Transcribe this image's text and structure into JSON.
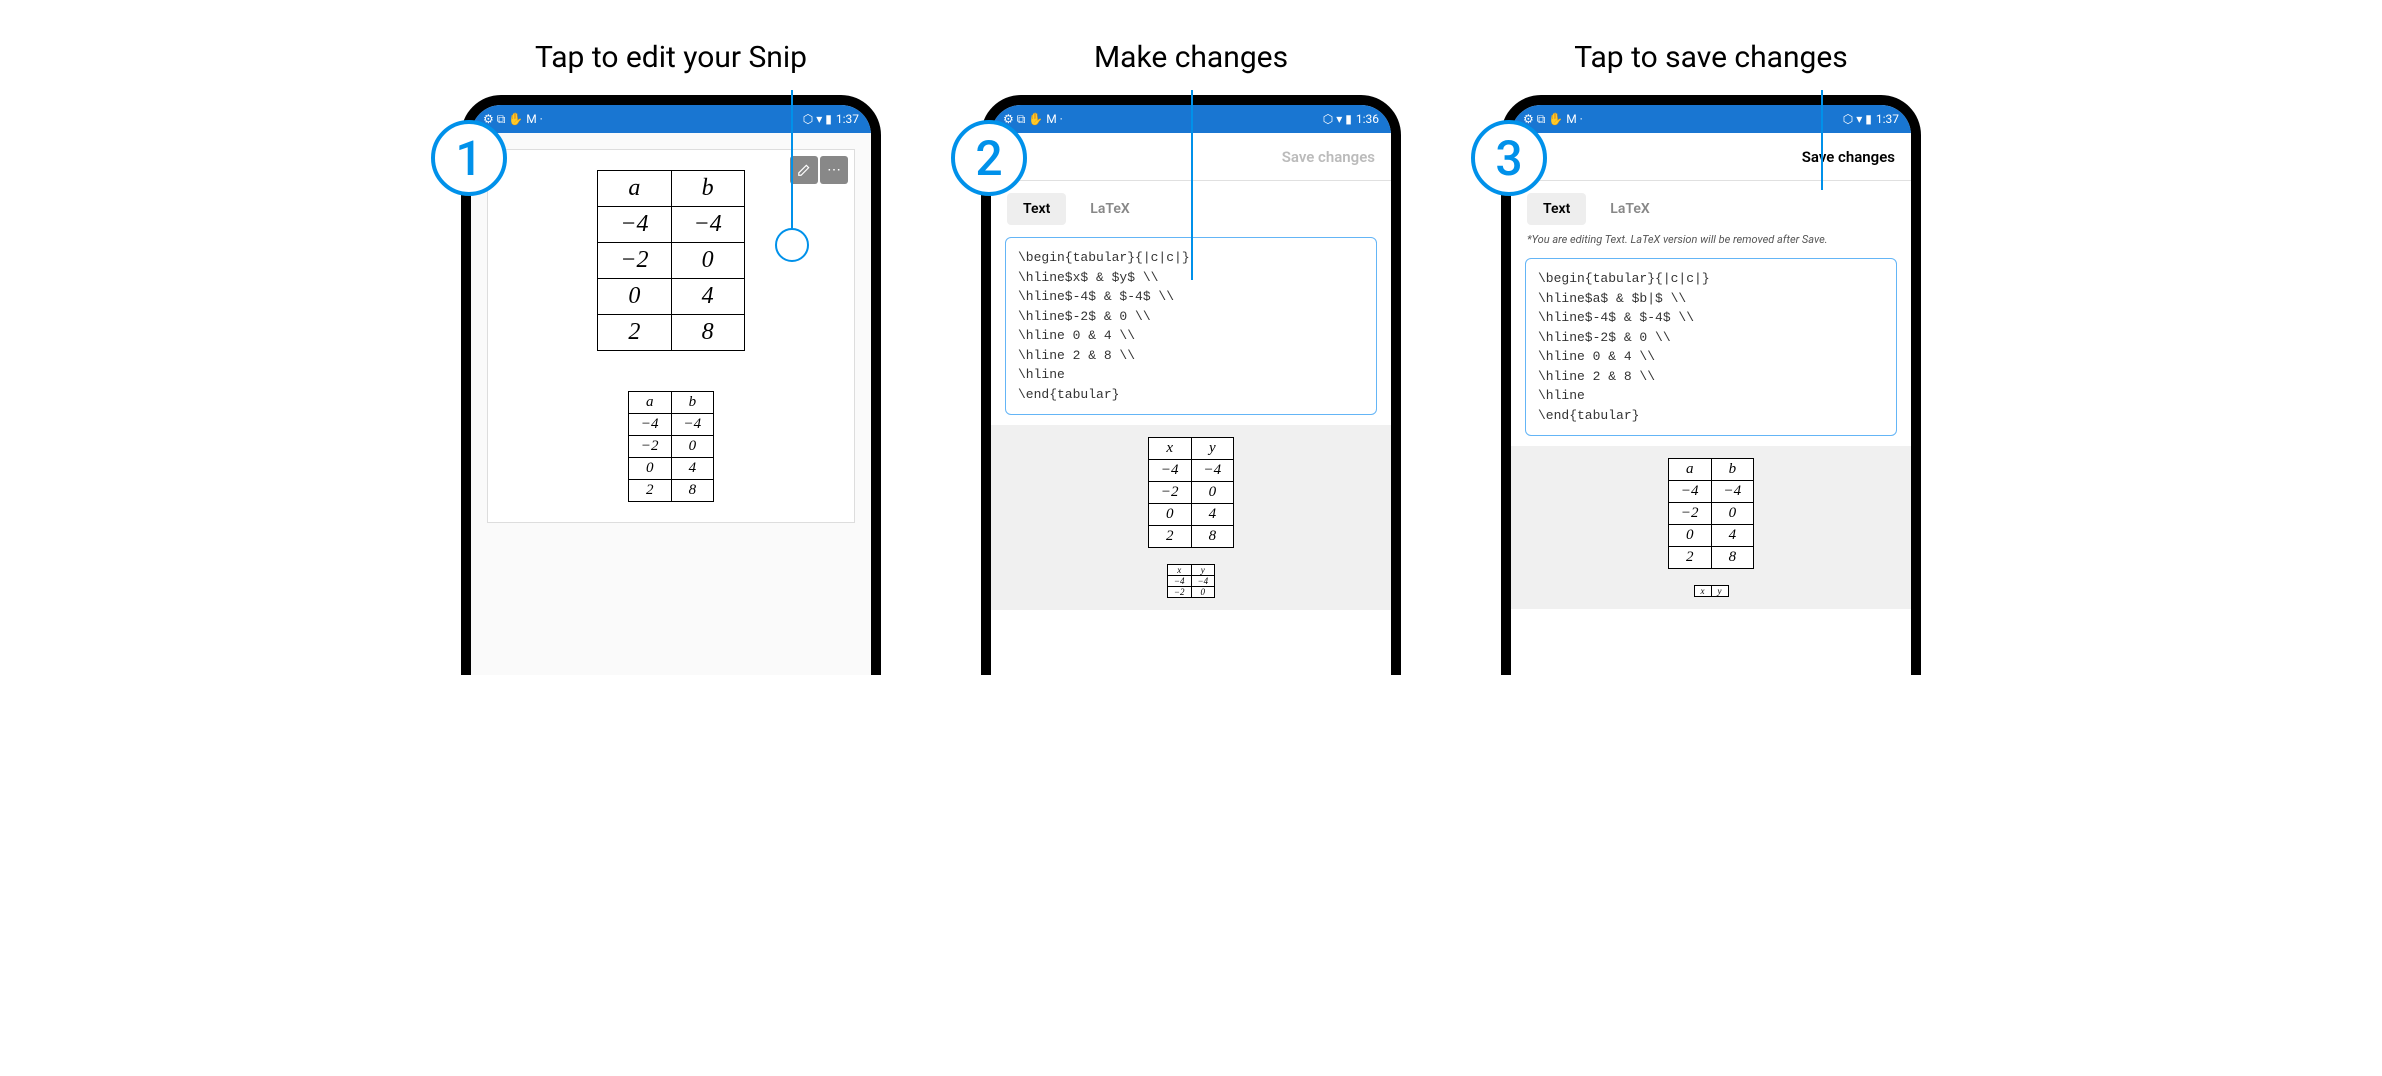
{
  "steps": [
    {
      "num": "1",
      "label": "Tap to edit your Snip"
    },
    {
      "num": "2",
      "label": "Make changes"
    },
    {
      "num": "3",
      "label": "Tap to save changes"
    }
  ],
  "status_bar": {
    "time": "1:37",
    "time2": "1:36",
    "left_icons": "⚙ ⧉ ✋ M ·",
    "right_icons": "⬡ ▾ ▮"
  },
  "app_bar": {
    "close": "✕",
    "save": "Save changes"
  },
  "tabs": {
    "text": "Text",
    "latex": "LaTeX"
  },
  "edit_note": "*You are editing Text. LaTeX version will be removed after Save.",
  "code_step2": "\\begin{tabular}{|c|c|}\n\\hline$x$ & $y$ \\\\\n\\hline$-4$ & $-4$ \\\\\n\\hline$-2$ & 0 \\\\\n\\hline 0 & 4 \\\\\n\\hline 2 & 8 \\\\\n\\hline\n\\end{tabular}",
  "code_step3": "\\begin{tabular}{|c|c|}\n\\hline$a$ & $b|$ \\\\\n\\hline$-4$ & $-4$ \\\\\n\\hline$-2$ & 0 \\\\\n\\hline 0 & 4 \\\\\n\\hline 2 & 8 \\\\\n\\hline\n\\end{tabular}",
  "table_ab": {
    "headers": [
      "a",
      "b"
    ],
    "rows": [
      [
        "−4",
        "−4"
      ],
      [
        "−2",
        "0"
      ],
      [
        "0",
        "4"
      ],
      [
        "2",
        "8"
      ]
    ]
  },
  "table_xy": {
    "headers": [
      "x",
      "y"
    ],
    "rows": [
      [
        "−4",
        "−4"
      ],
      [
        "−2",
        "0"
      ],
      [
        "0",
        "4"
      ],
      [
        "2",
        "8"
      ]
    ]
  },
  "chart_data": {
    "type": "table",
    "note": "Mobile app tutorial showing 3 steps for editing a LaTeX snip containing a table",
    "tables": [
      {
        "name": "ab",
        "headers": [
          "a",
          "b"
        ],
        "rows": [
          [
            -4,
            -4
          ],
          [
            -2,
            0
          ],
          [
            0,
            4
          ],
          [
            2,
            8
          ]
        ]
      },
      {
        "name": "xy",
        "headers": [
          "x",
          "y"
        ],
        "rows": [
          [
            -4,
            -4
          ],
          [
            -2,
            0
          ],
          [
            0,
            4
          ],
          [
            2,
            8
          ]
        ]
      }
    ]
  }
}
